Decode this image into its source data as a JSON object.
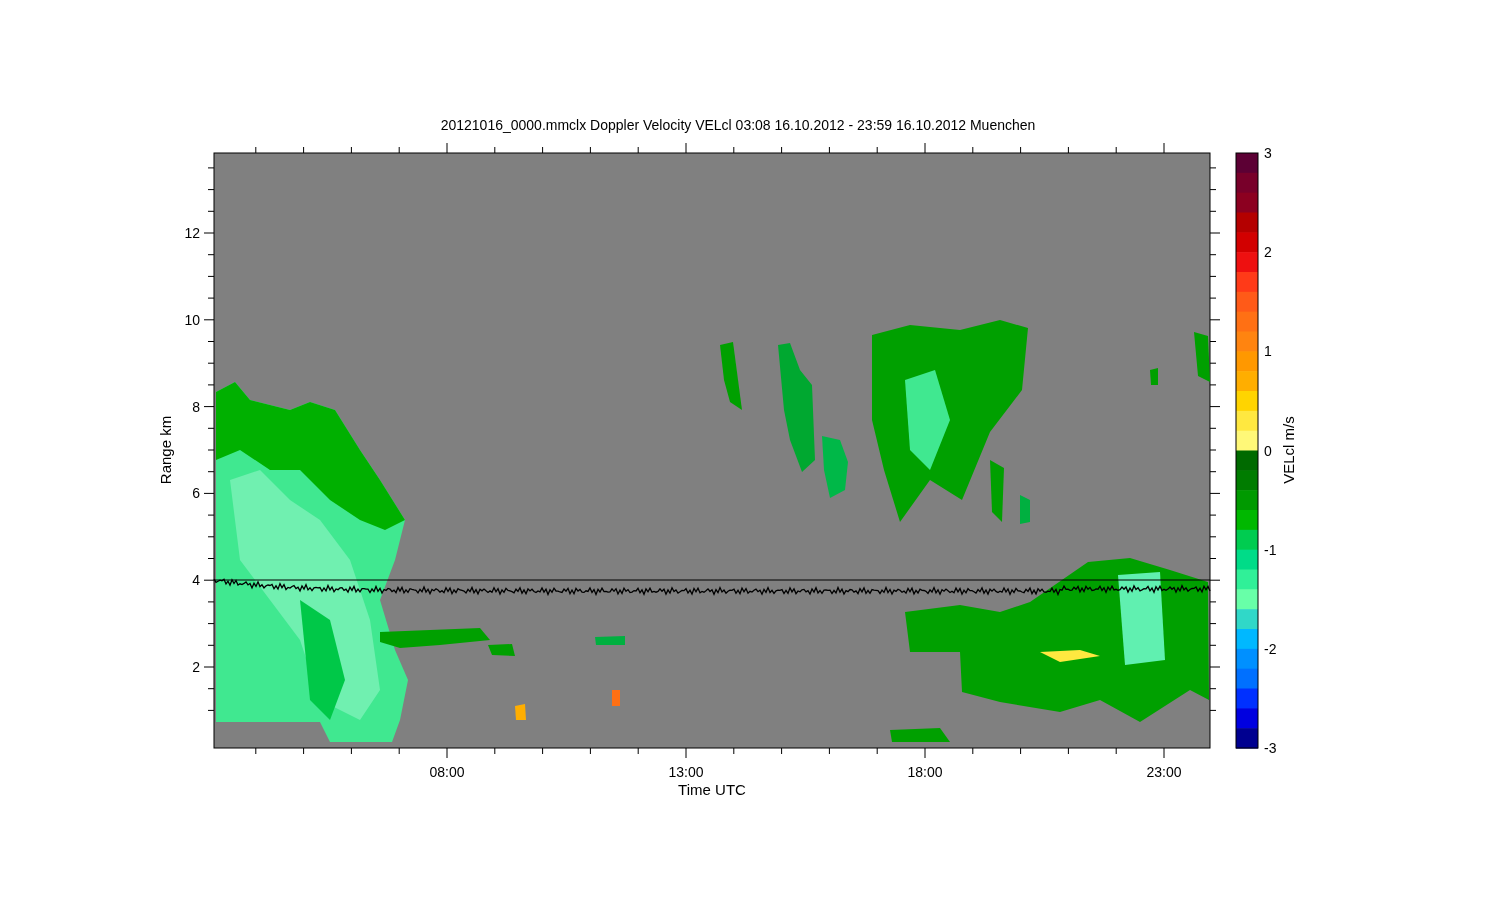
{
  "figure": {
    "title": "20121016_0000.mmclx Doppler Velocity VELcl   03:08 16.10.2012 - 23:59 16.10.2012 Muenchen",
    "x_axis": {
      "label": "Time UTC",
      "ticks": [
        "08:00",
        "13:00",
        "18:00",
        "23:00"
      ]
    },
    "y_axis": {
      "label": "Range km",
      "ticks": [
        "12",
        "10",
        "8",
        "6",
        "4",
        "2"
      ]
    },
    "colorbar": {
      "label": "VELcl m/s",
      "ticks": [
        "3",
        "2",
        "1",
        "0",
        "-1",
        "-2",
        "-3"
      ],
      "segments": [
        {
          "color": "#5c0034"
        },
        {
          "color": "#78002a"
        },
        {
          "color": "#8c0020"
        },
        {
          "color": "#b40000"
        },
        {
          "color": "#d20000"
        },
        {
          "color": "#ee1010"
        },
        {
          "color": "#ff3a18"
        },
        {
          "color": "#ff5a18"
        },
        {
          "color": "#ff7014"
        },
        {
          "color": "#ff8410"
        },
        {
          "color": "#ff9800"
        },
        {
          "color": "#ffae00"
        },
        {
          "color": "#ffd400"
        },
        {
          "color": "#ffe840"
        },
        {
          "color": "#fff878"
        },
        {
          "color": "#006a00"
        },
        {
          "color": "#007c00"
        },
        {
          "color": "#009a00"
        },
        {
          "color": "#00b800"
        },
        {
          "color": "#00cc50"
        },
        {
          "color": "#00dc88"
        },
        {
          "color": "#30f098"
        },
        {
          "color": "#68ffa8"
        },
        {
          "color": "#30d8c8"
        },
        {
          "color": "#00b8ff"
        },
        {
          "color": "#0090ff"
        },
        {
          "color": "#0070ff"
        },
        {
          "color": "#0030ff"
        },
        {
          "color": "#0000e0"
        },
        {
          "color": "#000090"
        }
      ]
    }
  }
}
